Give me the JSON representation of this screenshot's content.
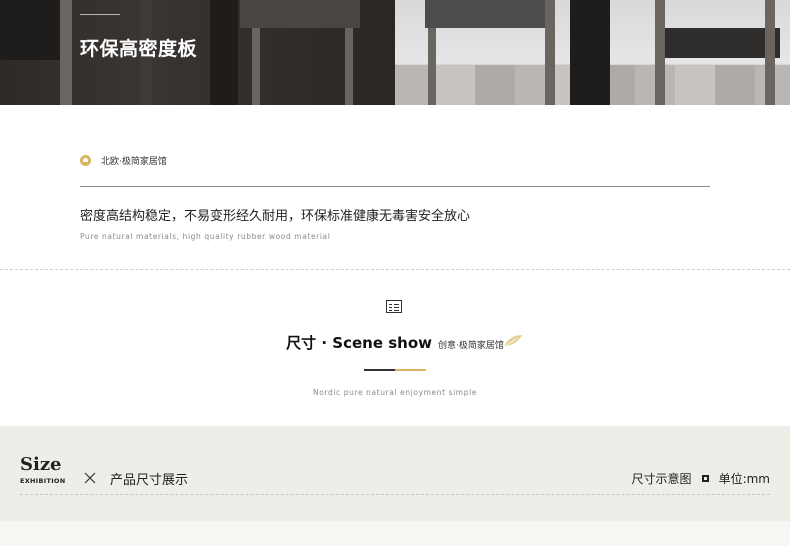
{
  "hero": {
    "title": "环保高密度板"
  },
  "intro": {
    "brand": "北欧·极简家居馆",
    "desc_cn": "密度高结构稳定，不易变形经久耐用，环保标准健康无毒害安全放心",
    "desc_en": "Pure natural materials, high quality rubber wood material"
  },
  "scene": {
    "title_main": "尺寸 · Scene show",
    "title_sub": "创意·极简家居馆",
    "en": "Nordic pure natural enjoyment simple"
  },
  "size_bar": {
    "logo": "Size",
    "logo_sub": "EXHIBITION",
    "title": "产品尺寸展示",
    "diagram_label": "尺寸示意图",
    "unit_label": "单位:mm"
  },
  "colors": {
    "gold": "#d9b564",
    "band_bg": "#efede8"
  }
}
